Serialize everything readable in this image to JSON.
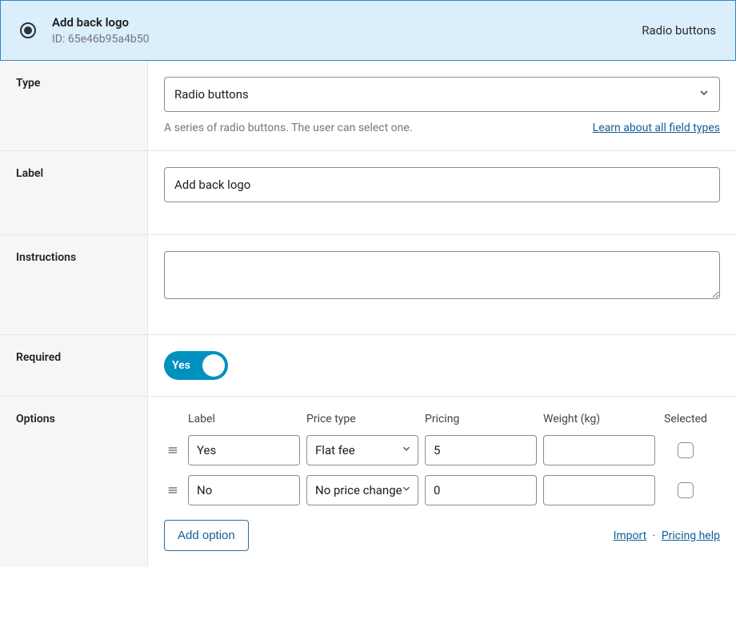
{
  "header": {
    "title": "Add back logo",
    "id_label": "ID: 65e46b95a4b50",
    "type_label": "Radio buttons"
  },
  "type_row": {
    "label": "Type",
    "selected": "Radio buttons",
    "hint": "A series of radio buttons. The user can select one.",
    "link": "Learn about all field types"
  },
  "label_row": {
    "label": "Label",
    "value": "Add back logo"
  },
  "instructions_row": {
    "label": "Instructions",
    "value": ""
  },
  "required_row": {
    "label": "Required",
    "toggle": "Yes"
  },
  "options_row": {
    "label": "Options",
    "columns": {
      "label": "Label",
      "price_type": "Price type",
      "pricing": "Pricing",
      "weight": "Weight (kg)",
      "selected": "Selected"
    },
    "rows": [
      {
        "label": "Yes",
        "price_type": "Flat fee",
        "pricing": "5",
        "weight": "",
        "selected": false
      },
      {
        "label": "No",
        "price_type": "No price change",
        "pricing": "0",
        "weight": "",
        "selected": false
      }
    ],
    "add_button": "Add option",
    "import_link": "Import",
    "pricing_help_link": "Pricing help"
  }
}
